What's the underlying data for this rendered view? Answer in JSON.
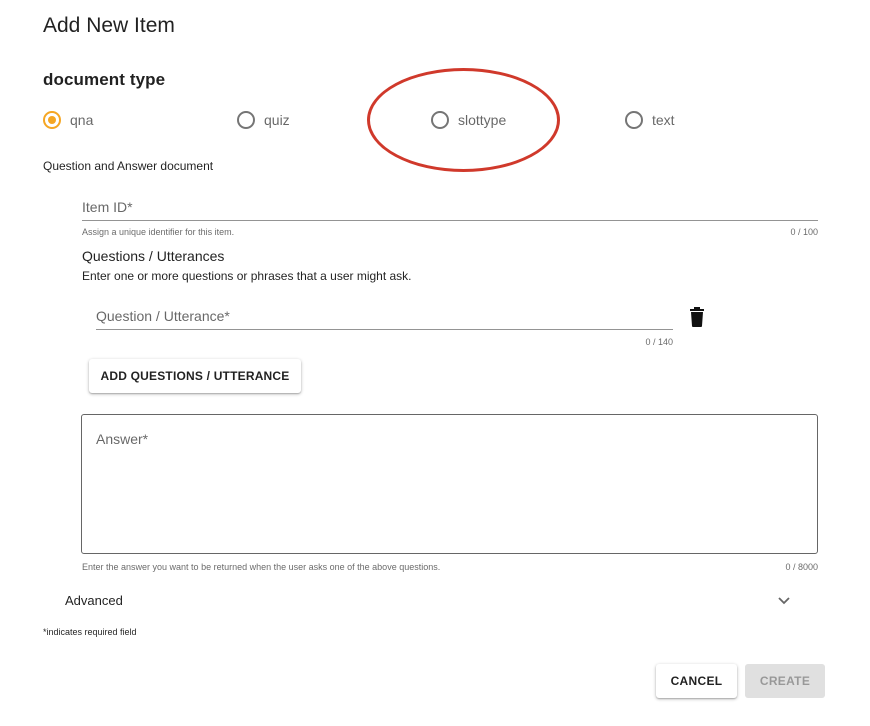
{
  "dialog": {
    "title": "Add New Item"
  },
  "document_type": {
    "heading": "document type",
    "options": [
      {
        "label": "qna",
        "selected": true
      },
      {
        "label": "quiz",
        "selected": false
      },
      {
        "label": "slottype",
        "selected": false
      },
      {
        "label": "text",
        "selected": false
      }
    ],
    "description": "Question and Answer document",
    "accent_color": "#f5a623"
  },
  "annotation": {
    "color": "#d0392b",
    "highlighted_option": "slottype"
  },
  "item_id": {
    "label": "Item ID*",
    "value": "",
    "hint": "Assign a unique identifier for this item.",
    "counter": "0 / 100"
  },
  "questions": {
    "title": "Questions / Utterances",
    "description": "Enter one or more questions or phrases that a user might ask.",
    "field_label": "Question / Utterance*",
    "value": "",
    "counter": "0 / 140",
    "delete_icon": "trash-icon",
    "add_button_label": "ADD QUESTIONS / UTTERANCE"
  },
  "answer": {
    "label": "Answer*",
    "value": "",
    "hint": "Enter the answer you want to be returned when the user asks one of the above questions.",
    "counter": "0 / 8000"
  },
  "advanced": {
    "label": "Advanced",
    "icon": "chevron-down-icon"
  },
  "required_note": "*indicates required field",
  "actions": {
    "cancel_label": "CANCEL",
    "create_label": "CREATE"
  }
}
